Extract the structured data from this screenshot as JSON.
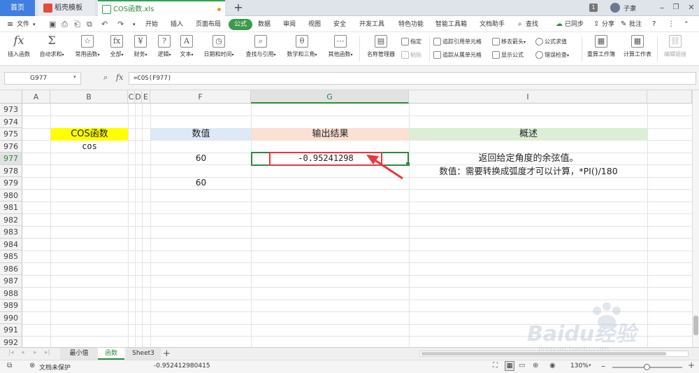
{
  "tabs": {
    "home": "首页",
    "template": "稻壳模板",
    "file": "COS函数.xls",
    "page_badge": "1",
    "user": "子隶"
  },
  "menubar": {
    "file_menu": "文件",
    "items": [
      "开始",
      "插入",
      "页面布局",
      "公式",
      "数据",
      "审阅",
      "视图",
      "安全",
      "开发工具",
      "特色功能",
      "智能工具箱",
      "文档助手"
    ],
    "search": "查找",
    "sync": "已同步",
    "share": "分享",
    "comment": "批注"
  },
  "ribbon": {
    "insert_function": "插入函数",
    "autosum": "自动求和",
    "common_funcs": "常用函数",
    "all": "全部",
    "finance": "财务",
    "logic": "逻辑",
    "text": "文本",
    "datetime": "日期和时间",
    "lookup": "查找与引用",
    "math": "数学和三角",
    "other": "其他函数",
    "name_manager": "名称管理器",
    "specify": "指定",
    "paste": "粘贴",
    "trace_precedents": "追踪引用单元格",
    "trace_dependents": "追踪从属单元格",
    "remove_arrows": "移去箭头",
    "show_formulas": "显示公式",
    "eval_formula": "公式求值",
    "error_check": "错误检查",
    "recalc_workbook": "重算工作簿",
    "calc_sheet": "计算工作表",
    "edit_links": "编辑链接"
  },
  "formula_bar": {
    "name_box": "G977",
    "fx": "fx",
    "formula": "=COS(F977)"
  },
  "columns": [
    "A",
    "B",
    "C",
    "D",
    "E",
    "F",
    "G",
    "I"
  ],
  "rows": [
    "973",
    "974",
    "975",
    "976",
    "977",
    "978",
    "979",
    "980",
    "981",
    "982",
    "983",
    "984",
    "985",
    "986",
    "987",
    "988",
    "989",
    "990",
    "991",
    "992"
  ],
  "cells": {
    "b975": "COS函数",
    "b976": "cos",
    "f975": "数值",
    "f977": "60",
    "f979": "60",
    "g975": "输出结果",
    "g977": "-0.95241298",
    "i975": "概述",
    "i977": "返回给定角度的余弦值。",
    "i978": "数值：需要转换成弧度才可以计算，*PI()/180"
  },
  "sheet_tabs": [
    "最小值",
    "函数",
    "Sheet3"
  ],
  "status": {
    "protection": "文档未保护",
    "value": "-0.952412980415",
    "zoom": "130%"
  },
  "watermark": {
    "brand": "Baidu经验",
    "url": "jingyan.baidu.com"
  },
  "colors": {
    "accent_green": "#3c9a4a",
    "header_yellow": "#ffff00",
    "header_blue": "#dde9f6",
    "header_salmon": "#fbe0d4",
    "header_green": "#dcefd6",
    "annotation_red": "#e8383d"
  }
}
